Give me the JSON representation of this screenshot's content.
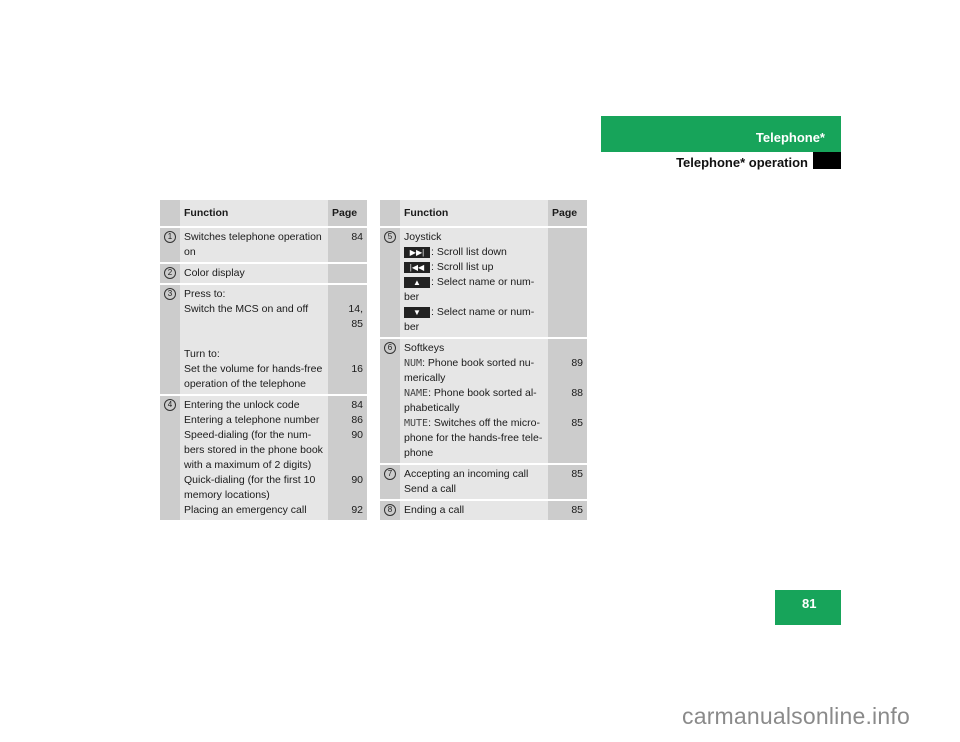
{
  "header": {
    "section": "Telephone*",
    "subsection": "Telephone* operation",
    "accent_color": "#17a45a"
  },
  "page_number": "81",
  "watermark": "carmanualsonline.info",
  "table_left": {
    "columns": {
      "function": "Function",
      "page": "Page"
    },
    "rows": [
      {
        "num": "1",
        "lines": [
          "Switches telephone operation",
          "on"
        ],
        "pages": [
          "84",
          ""
        ]
      },
      {
        "num": "2",
        "lines": [
          "Color display"
        ],
        "pages": [
          ""
        ]
      },
      {
        "num": "3",
        "lines": [
          "Press to:",
          "Switch the MCS on and off",
          "",
          "",
          "Turn to:",
          "Set the volume for hands-free",
          "operation of the telephone"
        ],
        "pages": [
          "",
          "14,",
          "85",
          "",
          "",
          "16",
          ""
        ]
      },
      {
        "num": "4",
        "lines": [
          "Entering the unlock code",
          "Entering a telephone number",
          "Speed-dialing (for the num-",
          "bers stored in the phone book",
          "with a maximum of 2 digits)",
          "Quick-dialing (for the first 10",
          "memory locations)",
          "Placing an emergency call"
        ],
        "pages": [
          "84",
          "86",
          "90",
          "",
          "",
          "90",
          "",
          "92"
        ]
      }
    ]
  },
  "table_right": {
    "columns": {
      "function": "Function",
      "page": "Page"
    },
    "rows": [
      {
        "num": "5",
        "title": "Joystick",
        "keys": [
          {
            "icon": "skip-forward-icon",
            "glyph": "▶▶|",
            "text": ": Scroll list down"
          },
          {
            "icon": "skip-back-icon",
            "glyph": "|◀◀",
            "text": ": Scroll list up"
          },
          {
            "icon": "arrow-up-icon",
            "glyph": "▲",
            "text": ": Select name or num-",
            "cont": "ber"
          },
          {
            "icon": "arrow-down-icon",
            "glyph": "▼",
            "text": ": Select name or num-",
            "cont": "ber"
          }
        ]
      },
      {
        "num": "6",
        "title": "Softkeys",
        "softkeys": [
          {
            "key": "NUM",
            "text": ": Phone book sorted nu-",
            "cont": [
              "merically"
            ],
            "page": "89"
          },
          {
            "key": "NAME",
            "text": ": Phone book sorted al-",
            "cont": [
              "phabetically"
            ],
            "page": "88"
          },
          {
            "key": "MUTE",
            "text": ": Switches off the micro-",
            "cont": [
              "phone for the hands-free tele-",
              "phone"
            ],
            "page": "85"
          }
        ]
      },
      {
        "num": "7",
        "lines": [
          "Accepting an incoming call",
          "Send a call"
        ],
        "pages": [
          "85",
          ""
        ]
      },
      {
        "num": "8",
        "lines": [
          "Ending a call"
        ],
        "pages": [
          "85"
        ]
      }
    ]
  }
}
